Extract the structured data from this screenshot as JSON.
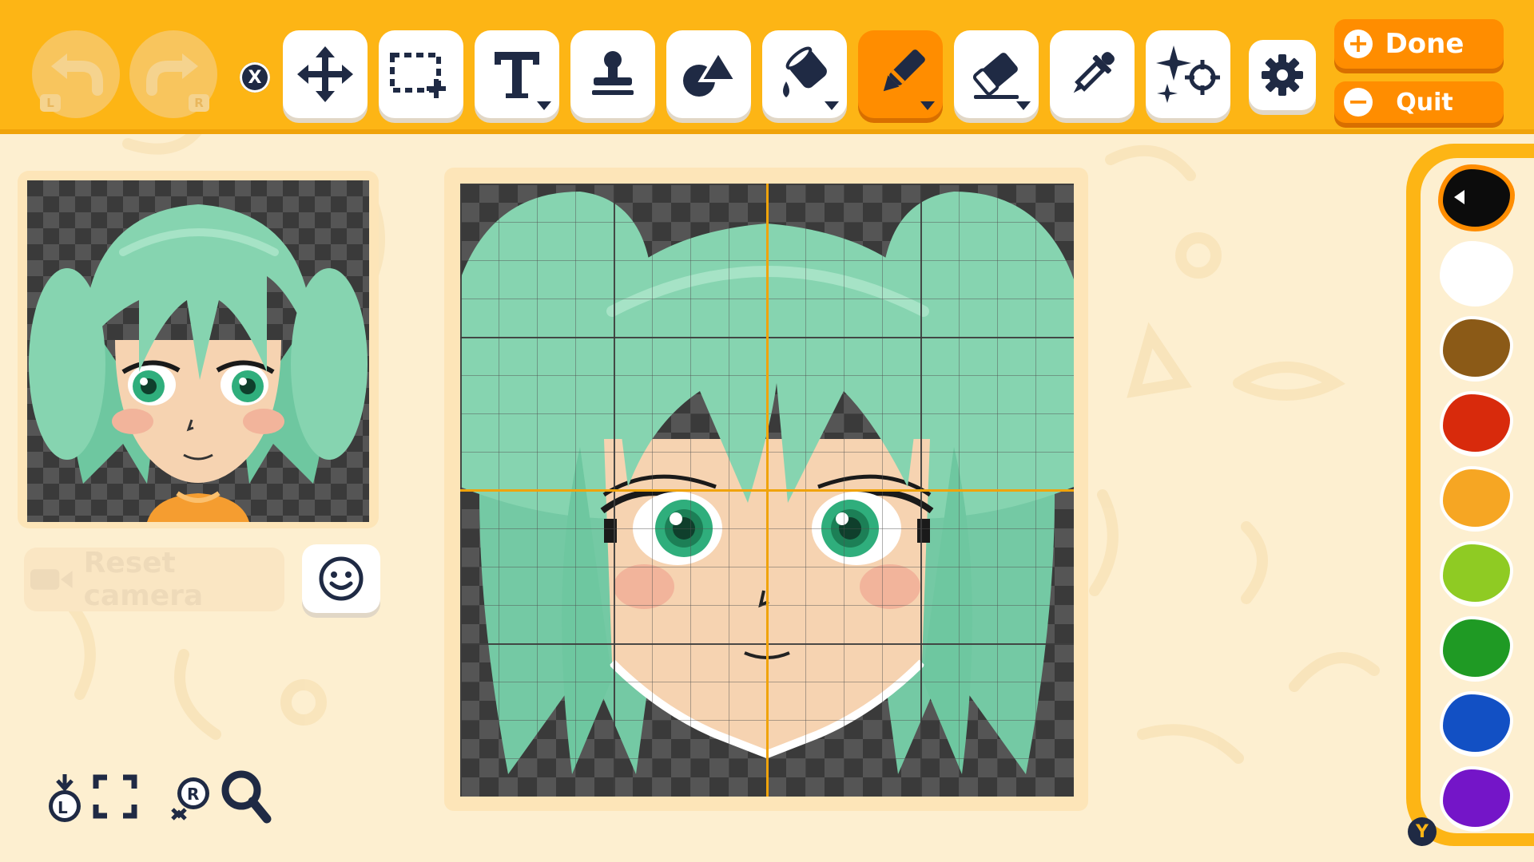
{
  "toolbar": {
    "undo_key": "L",
    "redo_key": "R",
    "close_key": "X",
    "tools": [
      {
        "name": "move",
        "icon": "move-arrows-icon"
      },
      {
        "name": "select",
        "icon": "selection-icon"
      },
      {
        "name": "text",
        "icon": "text-icon",
        "has_menu": true
      },
      {
        "name": "stamp",
        "icon": "stamp-icon"
      },
      {
        "name": "shape",
        "icon": "shapes-icon"
      },
      {
        "name": "fill",
        "icon": "paint-bucket-icon",
        "has_menu": true
      },
      {
        "name": "pen",
        "icon": "pen-icon",
        "has_menu": true,
        "active": true
      },
      {
        "name": "eraser",
        "icon": "eraser-icon",
        "has_menu": true
      },
      {
        "name": "eyedropper",
        "icon": "eyedropper-icon"
      },
      {
        "name": "effects",
        "icon": "sparkle-target-icon"
      }
    ],
    "done_label": "Done",
    "done_symbol": "+",
    "quit_label": "Quit",
    "quit_symbol": "−"
  },
  "preview": {
    "reset_camera_label": "Reset camera"
  },
  "palette": {
    "colors": [
      "#0c0c0c",
      "#ffffff",
      "#8b5a17",
      "#d82a0c",
      "#f6a623",
      "#8fcb23",
      "#1f9a24",
      "#1250c4",
      "#7415c8"
    ],
    "selected_index": 0,
    "y_key": "Y"
  },
  "controls": {
    "l_key": "L",
    "r_key": "R"
  },
  "colors": {
    "accent": "#fdb515",
    "active": "#ff8d00",
    "hair": "#86d4b0",
    "skin": "#f6d3b1",
    "eye": "#2fae7c"
  }
}
